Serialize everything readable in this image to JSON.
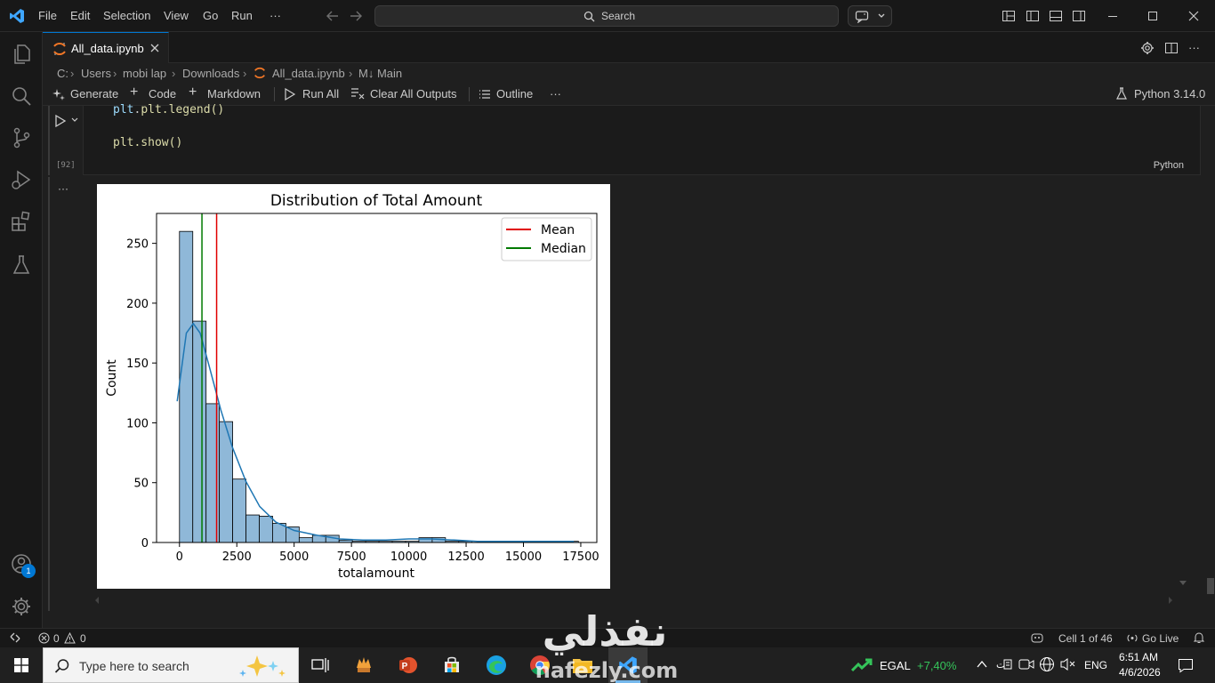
{
  "menu": [
    "File",
    "Edit",
    "Selection",
    "View",
    "Go",
    "Run",
    "···"
  ],
  "search": {
    "label": "Search"
  },
  "tab": {
    "label": "All_data.ipynb"
  },
  "breadcrumb": [
    "C:",
    "Users",
    "mobi lap",
    "Downloads",
    "All_data.ipynb",
    "M↓ Main"
  ],
  "toolbar": {
    "generate": "Generate",
    "code": "Code",
    "markdown": "Markdown",
    "run_all": "Run All",
    "clear_outputs": "Clear All Outputs",
    "outline": "Outline",
    "more": "···",
    "kernel": "Python 3.14.0"
  },
  "cell": {
    "line1": "plt.legend()",
    "line2": "plt.show()",
    "exec_count": "[92]",
    "language": "Python",
    "output_menu": "···"
  },
  "chart_data": {
    "type": "bar",
    "title": "Distribution of Total Amount",
    "xlabel": "totalamount",
    "ylabel": "Count",
    "xlim": [
      -1000,
      18200
    ],
    "ylim": [
      0,
      275
    ],
    "xticks": [
      0,
      2500,
      5000,
      7500,
      10000,
      12500,
      15000,
      17500
    ],
    "xtick_labels": [
      "0",
      "2500",
      "5000",
      "7500",
      "10000",
      "12500",
      "15000",
      "17500"
    ],
    "yticks": [
      0,
      50,
      100,
      150,
      200,
      250
    ],
    "ytick_labels": [
      "0",
      "50",
      "100",
      "150",
      "200",
      "250"
    ],
    "bin_start": 0,
    "bin_width": 580,
    "counts": [
      260,
      185,
      116,
      101,
      53,
      23,
      22,
      16,
      13,
      4,
      6,
      6,
      2,
      1,
      1,
      1,
      1,
      1,
      4,
      4,
      1,
      1,
      0,
      0,
      0,
      0,
      1,
      1,
      1,
      1
    ],
    "kde": [
      [
        -100,
        118
      ],
      [
        300,
        175
      ],
      [
        600,
        183
      ],
      [
        900,
        175
      ],
      [
        1300,
        147
      ],
      [
        1800,
        111
      ],
      [
        2300,
        80
      ],
      [
        2900,
        51
      ],
      [
        3500,
        30
      ],
      [
        4200,
        17
      ],
      [
        5000,
        10
      ],
      [
        6000,
        6
      ],
      [
        7000,
        3
      ],
      [
        8000,
        2
      ],
      [
        9000,
        2
      ],
      [
        10000,
        3
      ],
      [
        11000,
        3
      ],
      [
        12000,
        2
      ],
      [
        13000,
        1
      ],
      [
        14500,
        1
      ],
      [
        17200,
        1
      ]
    ],
    "mean": 1620,
    "median": 980,
    "legend": {
      "position": "top-right",
      "entries": [
        {
          "name": "Mean",
          "color": "#e00000"
        },
        {
          "name": "Median",
          "color": "#007a00"
        }
      ]
    },
    "colors": {
      "bar_fill": "#8fb8d8",
      "bar_edge": "#000000",
      "kde": "#1f77b4"
    }
  },
  "status": {
    "errors": "0",
    "warnings": "0",
    "cell_pos": "Cell 1 of 46",
    "go_live": "Go Live",
    "badge": "1"
  },
  "taskbar": {
    "search_placeholder": "Type here to search",
    "stock_name": "EGAL",
    "stock_change": "+7,40%",
    "lang": "ENG",
    "time": "6:51 AM",
    "date": "4/6/2026"
  },
  "watermark": {
    "arabic": "نفذلي",
    "latin": "nafezly.com"
  }
}
